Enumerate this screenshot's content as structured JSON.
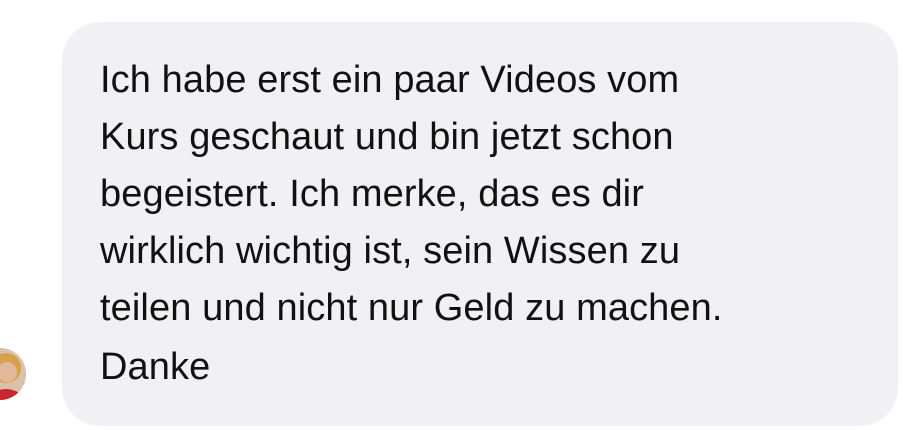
{
  "message": {
    "lines": [
      "Ich habe erst ein paar Videos vom",
      "Kurs geschaut und bin jetzt schon",
      "begeistert. Ich merke, das es dir",
      "wirklich wichtig ist, sein Wissen zu",
      "teilen und nicht nur Geld zu machen."
    ],
    "signoff": "Danke"
  },
  "avatar": {
    "icon": "user-avatar",
    "colors": {
      "skin": "#e4b99a",
      "hair": "#d8a04a",
      "shirt": "#c8262c"
    }
  },
  "colors": {
    "bubble": "#f1f1f5",
    "text": "#111111",
    "background": "#ffffff"
  }
}
